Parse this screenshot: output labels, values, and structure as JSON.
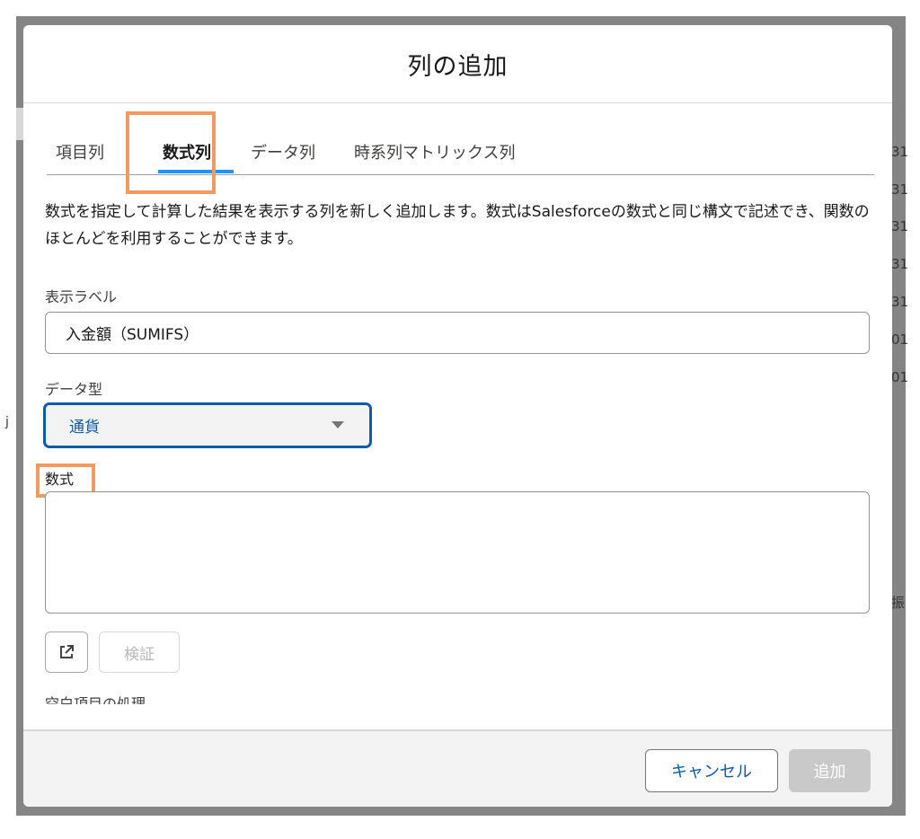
{
  "modal": {
    "title": "列の追加"
  },
  "tabs": [
    {
      "label": "項目列",
      "active": false
    },
    {
      "label": "数式列",
      "active": true
    },
    {
      "label": "データ列",
      "active": false
    },
    {
      "label": "時系列マトリックス列",
      "active": false
    }
  ],
  "description": "数式を指定して計算した結果を表示する列を新しく追加します。数式はSalesforceの数式と同じ構文で記述でき、関数のほとんどを利用することができます。",
  "fields": {
    "display_label": {
      "label": "表示ラベル",
      "value": "入金額（SUMIFS）"
    },
    "data_type": {
      "label": "データ型",
      "value": "通貨"
    },
    "formula": {
      "label": "数式",
      "value": ""
    }
  },
  "buttons": {
    "open_editor_icon": "external-link-icon",
    "verify": "検証",
    "cancel": "キャンセル",
    "add": "追加"
  },
  "cut_off_label": "空白項目の処理",
  "background": {
    "right_edge_glyphs": [
      "31",
      "31",
      "31",
      "31",
      "31",
      "01",
      "01",
      "振"
    ],
    "left_edge_glyph": "j"
  },
  "colors": {
    "accent_blue": "#0b5cab",
    "tab_underline": "#1b96ff",
    "highlight_orange": "#f39b5e",
    "disabled_button": "#c9c9c9"
  }
}
